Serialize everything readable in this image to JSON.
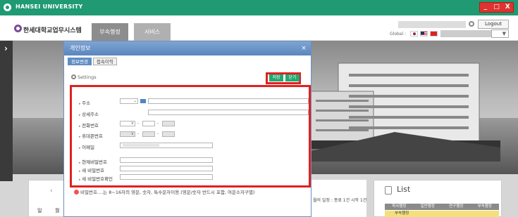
{
  "window": {
    "title": "HANSEI UNIVERSITY",
    "buttons": [
      "_",
      "□",
      "X"
    ]
  },
  "header": {
    "logo_text": "한세대학교업무시스템",
    "tabs": [
      "부속행정",
      "서비스"
    ],
    "logout_label": "Logout",
    "global_label": "Global :",
    "lang_select_value": "▼"
  },
  "dialog": {
    "title": "개인정보",
    "close_label": "×",
    "tabs": [
      "정보변경",
      "접속이력"
    ],
    "settings_label": "Settings",
    "save_label": "저장",
    "close_button_label": "닫기",
    "fields": {
      "address": "주소",
      "address_detail": "상세주소",
      "phone": "전화번호",
      "mobile": "휴대폰번호",
      "email": "이메일",
      "current_password": "현재비밀번호",
      "new_password": "새 비밀번호",
      "confirm_password": "새 비밀번호확인"
    },
    "note": "비밀번호....는 8~16자의 영문, 숫자, 특수문자이용.(영문/숫자 반드시 포함, 여문소자구별)"
  },
  "background": {
    "left_arrow": "‹",
    "day_labels": [
      "일",
      "월"
    ],
    "schedule_text": "월의 일정 : 종료 1건 시작 1건",
    "list_title": "List",
    "list_headers": [
      "학사행정",
      "일반행정",
      "연구행정",
      "부속행정"
    ],
    "list_row": "부속행정"
  }
}
